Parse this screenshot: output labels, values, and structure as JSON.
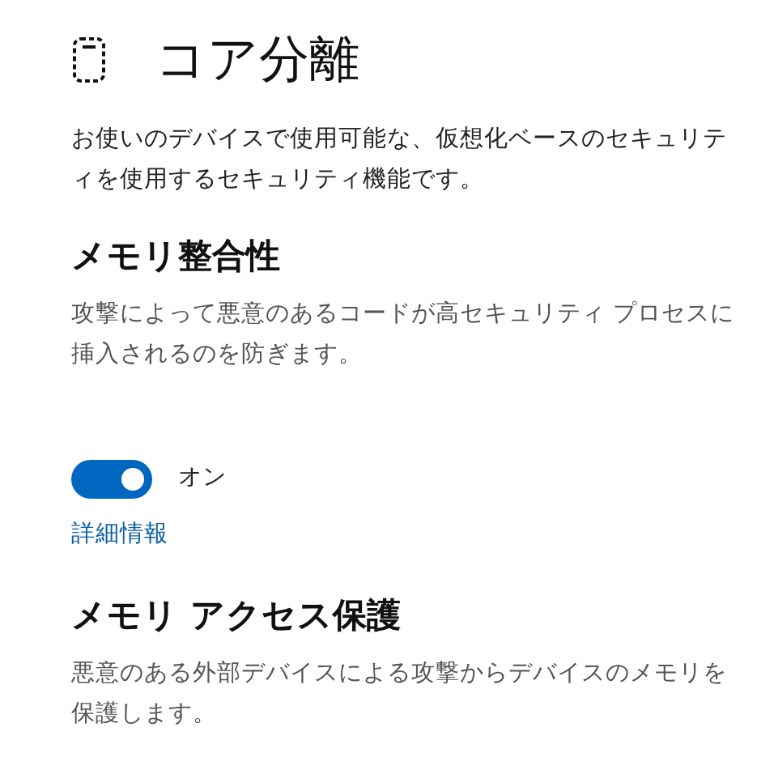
{
  "title": "コア分離",
  "description": "お使いのデバイスで使用可能な、仮想化ベースのセキュリティを使用するセキュリティ機能です。",
  "sections": [
    {
      "heading": "メモリ整合性",
      "description": "攻撃によって悪意のあるコードが高セキュリティ プロセスに挿入されるのを防ぎます。",
      "toggle": {
        "on": true,
        "label": "オン"
      },
      "link": "詳細情報"
    },
    {
      "heading": "メモリ アクセス保護",
      "description": "悪意のある外部デバイスによる攻撃からデバイスのメモリを保護します。"
    }
  ]
}
